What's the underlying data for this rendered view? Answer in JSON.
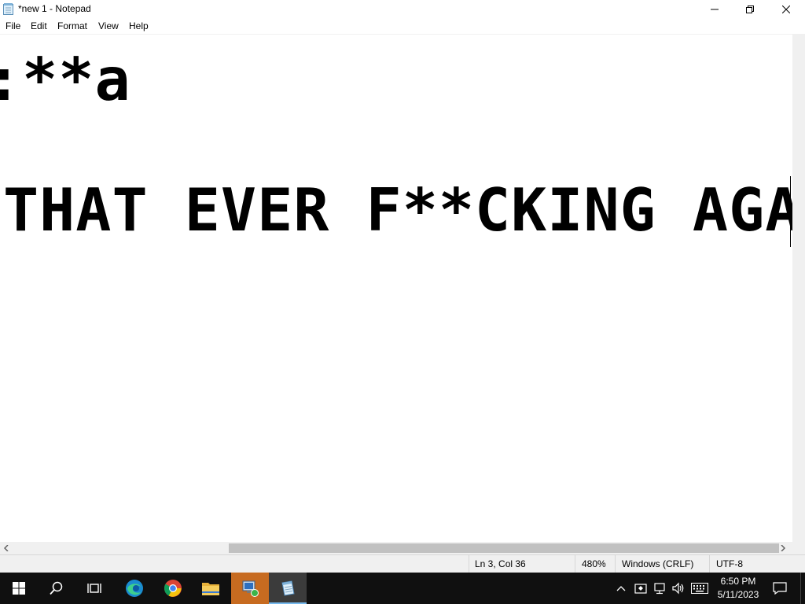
{
  "window": {
    "title": "*new 1 - Notepad"
  },
  "menu": [
    "File",
    "Edit",
    "Format",
    "View",
    "Help"
  ],
  "editor": {
    "lines": [
      ":**a",
      "",
      "THAT EVER F**CKING AGAIN."
    ]
  },
  "status": {
    "position": "Ln 3, Col 36",
    "zoom": "480%",
    "line_ending": "Windows (CRLF)",
    "encoding": "UTF-8"
  },
  "taskbar": {
    "apps": [
      "start-icon",
      "search-icon",
      "task-view-icon",
      "edge-icon",
      "chrome-icon",
      "file-explorer-icon",
      "network-app-icon",
      "notepad-icon"
    ],
    "clock_time": "6:50 PM",
    "clock_date": "5/11/2023"
  },
  "colors": {
    "taskbar_bg": "#101010",
    "active_accent": "#76b9ed",
    "statusbar_bg": "#f0f0f0"
  }
}
